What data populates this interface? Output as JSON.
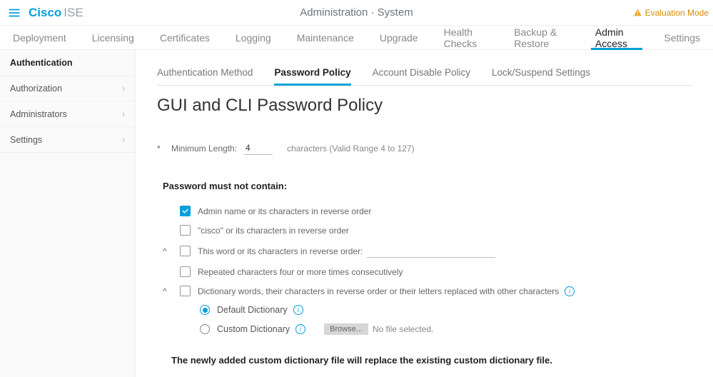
{
  "brand": {
    "a": "Cisco",
    "b": "ISE"
  },
  "breadcrumb": "Administration · System",
  "eval_mode": "Evaluation Mode",
  "main_tabs": {
    "deployment": "Deployment",
    "licensing": "Licensing",
    "certificates": "Certificates",
    "logging": "Logging",
    "maintenance": "Maintenance",
    "upgrade": "Upgrade",
    "health": "Health Checks",
    "backup": "Backup & Restore",
    "admin": "Admin Access",
    "settings": "Settings"
  },
  "sidebar": {
    "authentication": "Authentication",
    "authorization": "Authorization",
    "administrators": "Administrators",
    "settings": "Settings"
  },
  "subtabs": {
    "auth_method": "Authentication Method",
    "pw_policy": "Password Policy",
    "acct_disable": "Account Disable Policy",
    "lock": "Lock/Suspend Settings"
  },
  "title": "GUI and CLI Password Policy",
  "min_len": {
    "label": "Minimum Length:",
    "value": "4",
    "hint": "characters (Valid Range 4 to 127)"
  },
  "must_not": "Password must not contain:",
  "rules": {
    "admin_name": "Admin name or its characters in reverse order",
    "cisco": "\"cisco\"  or its characters in reverse order",
    "this_word": "This word or its characters in reverse order:",
    "repeated": "Repeated characters four or more times consecutively",
    "dictionary": "Dictionary words, their characters in reverse order or their letters replaced with other characters"
  },
  "dict": {
    "default": "Default Dictionary",
    "custom": "Custom Dictionary",
    "browse": "Browse...",
    "nofile": "No file selected."
  },
  "note": "The newly added custom dictionary file will replace the existing custom dictionary file."
}
